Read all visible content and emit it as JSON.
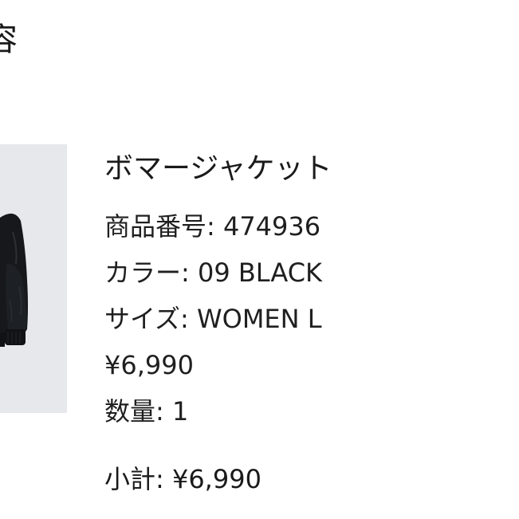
{
  "order": {
    "section_heading": "容",
    "item": {
      "name": "ボマージャケット",
      "product_number": "商品番号: 474936",
      "color": "カラー: 09 BLACK",
      "size": "サイズ: WOMEN L",
      "price": "¥6,990",
      "quantity": "数量: 1",
      "thumbnail": {
        "background_color": "#e6e8eb",
        "jacket_color": "#16181b"
      }
    },
    "subtotal": "小計: ¥6,990"
  }
}
